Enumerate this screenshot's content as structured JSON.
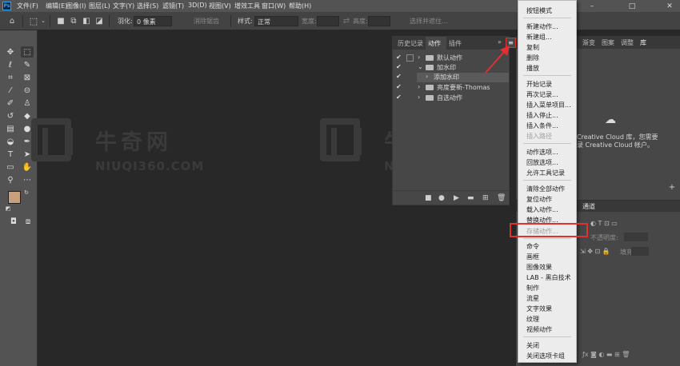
{
  "menubar": {
    "logo": "Ps",
    "items": [
      "文件(F)",
      "编辑(E)",
      "图像(I)",
      "图层(L)",
      "文字(Y)",
      "选择(S)",
      "滤镜(T)",
      "3D(D)",
      "视图(V)",
      "增效工具",
      "窗口(W)",
      "帮助(H)"
    ]
  },
  "options_bar": {
    "feather_label": "羽化:",
    "feather_value": "0 像素",
    "antialias_label": "消除锯齿",
    "style_label": "样式:",
    "style_value": "正常",
    "width_label": "宽度:",
    "height_label": "高度:",
    "select_subject_label": "选择并遮住..."
  },
  "watermark": {
    "cn": "牛奇网",
    "en": "NIUQI360.COM"
  },
  "actions_panel": {
    "tabs": [
      "历史记录",
      "动作",
      "插件"
    ],
    "rows": [
      {
        "label": "默认动作",
        "type": "set",
        "expanded": false
      },
      {
        "label": "加水印",
        "type": "set",
        "expanded": true
      },
      {
        "label": "添加水印",
        "type": "action",
        "highlighted": true
      },
      {
        "label": "亮度要新-Thomas",
        "type": "set",
        "expanded": false
      },
      {
        "label": "自选动作",
        "type": "set",
        "expanded": false
      }
    ]
  },
  "right_panel": {
    "tabs": [
      "渐变",
      "图案",
      "调整",
      "库"
    ],
    "cc_line1": "Creative Cloud 库，您需要",
    "cc_line2": "录 Creative Cloud 帐户。",
    "layers_tab": "通道",
    "opacity_label": "不透明度:",
    "fill_label": "填充:"
  },
  "dropdown": {
    "groups": [
      [
        {
          "label": "按钮模式",
          "disabled": false
        }
      ],
      [
        {
          "label": "新建动作...",
          "disabled": false
        },
        {
          "label": "新建组...",
          "disabled": false
        },
        {
          "label": "复制",
          "disabled": false
        },
        {
          "label": "删除",
          "disabled": false
        },
        {
          "label": "播放",
          "disabled": false
        }
      ],
      [
        {
          "label": "开始记录",
          "disabled": false
        },
        {
          "label": "再次记录...",
          "disabled": false
        },
        {
          "label": "插入菜单项目...",
          "disabled": false
        },
        {
          "label": "插入停止...",
          "disabled": false
        },
        {
          "label": "插入条件...",
          "disabled": false
        },
        {
          "label": "插入路径",
          "disabled": true
        }
      ],
      [
        {
          "label": "动作选项...",
          "disabled": false
        },
        {
          "label": "回放选项...",
          "disabled": false
        },
        {
          "label": "允许工具记录",
          "disabled": false
        }
      ],
      [
        {
          "label": "清除全部动作",
          "disabled": false
        },
        {
          "label": "复位动作",
          "disabled": false
        },
        {
          "label": "载入动作...",
          "disabled": false
        },
        {
          "label": "替换动作...",
          "disabled": false
        },
        {
          "label": "存储动作...",
          "disabled": true
        }
      ],
      [
        {
          "label": "命令",
          "disabled": false
        },
        {
          "label": "画框",
          "disabled": false
        },
        {
          "label": "图像效果",
          "disabled": false
        },
        {
          "label": "LAB - 黑白技术",
          "disabled": false
        },
        {
          "label": "制作",
          "disabled": false
        },
        {
          "label": "流星",
          "disabled": false
        },
        {
          "label": "文字效果",
          "disabled": false
        },
        {
          "label": "纹理",
          "disabled": false
        },
        {
          "label": "视频动作",
          "disabled": false
        }
      ],
      [
        {
          "label": "关闭",
          "disabled": false
        },
        {
          "label": "关闭选项卡组",
          "disabled": false
        }
      ]
    ]
  },
  "colors": {
    "foreground": "#c9a07e",
    "background": "#ffffff",
    "highlight": "#e03030"
  }
}
